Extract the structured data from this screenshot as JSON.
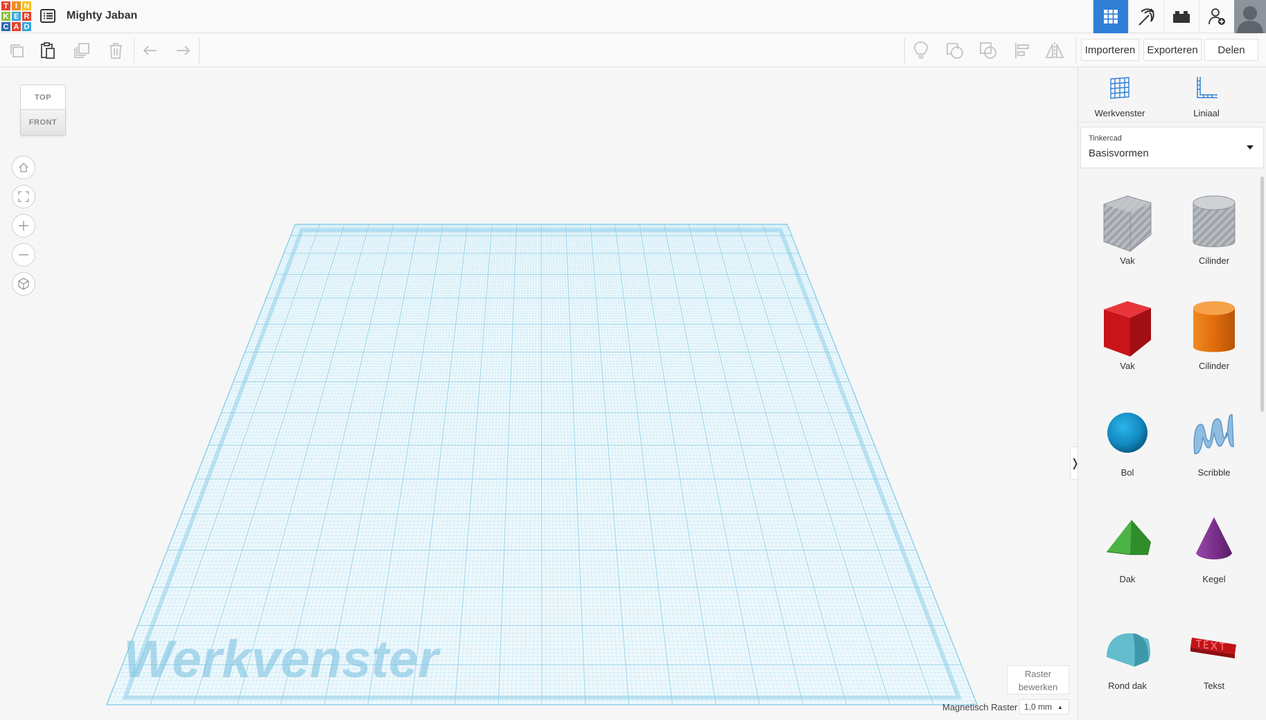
{
  "app": {
    "logo_letters": [
      "T",
      "I",
      "N",
      "K",
      "E",
      "R",
      "C",
      "A",
      "D"
    ],
    "logo_colors": [
      "#e7412b",
      "#ef8d22",
      "#f6c11a",
      "#8ac43f",
      "#35a8dd",
      "#e7412b",
      "#2b6cb3",
      "#e7412b",
      "#35a8dd"
    ],
    "design_title": "Mighty Jaban",
    "accent_color": "#2f7fd6"
  },
  "header": {
    "buttons": [
      {
        "name": "3d-design-icon",
        "active": true
      },
      {
        "name": "pickaxe-icon",
        "active": false
      },
      {
        "name": "bricks-icon",
        "active": false
      },
      {
        "name": "add-user-icon",
        "active": false
      }
    ]
  },
  "toolbar": {
    "import_label": "Importeren",
    "export_label": "Exporteren",
    "share_label": "Delen"
  },
  "viewcube": {
    "top_label": "TOP",
    "front_label": "FRONT"
  },
  "workplane": {
    "watermark": "Werkvenster",
    "grid_color": "#8fd0ea",
    "edit_grid_line1": "Raster",
    "edit_grid_line2": "bewerken",
    "snap_label": "Magnetisch Raster",
    "snap_value": "1,0 mm"
  },
  "panel": {
    "workplane_label": "Werkvenster",
    "ruler_label": "Liniaal",
    "library_category": "Tinkercad",
    "library_name": "Basisvormen",
    "shapes": [
      {
        "label": "Vak",
        "icon": "box-hole-icon",
        "color": "#a9aeb4"
      },
      {
        "label": "Cilinder",
        "icon": "cylinder-hole-icon",
        "color": "#a9aeb4"
      },
      {
        "label": "Vak",
        "icon": "box-icon",
        "color": "#d3151b"
      },
      {
        "label": "Cilinder",
        "icon": "cylinder-icon",
        "color": "#e8750e"
      },
      {
        "label": "Bol",
        "icon": "sphere-icon",
        "color": "#1593c9"
      },
      {
        "label": "Scribble",
        "icon": "scribble-icon",
        "color": "#86b6dc"
      },
      {
        "label": "Dak",
        "icon": "roof-icon",
        "color": "#3ea137"
      },
      {
        "label": "Kegel",
        "icon": "cone-icon",
        "color": "#7e2e8f"
      },
      {
        "label": "Rond dak",
        "icon": "round-roof-icon",
        "color": "#53b2c4"
      },
      {
        "label": "Tekst",
        "icon": "text-icon",
        "color": "#d3151b"
      }
    ]
  }
}
